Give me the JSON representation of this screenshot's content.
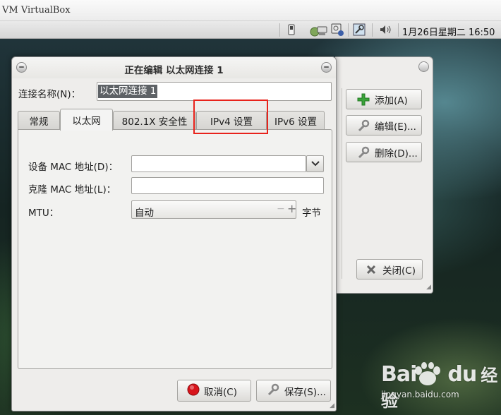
{
  "app": {
    "title": "VM VirtualBox"
  },
  "panel": {
    "clock": "1月26日星期二 16:50",
    "icons": [
      "power-indicator-icon",
      "network-manager-icon",
      "removable-drive-icon",
      "keyboard-settings-icon",
      "volume-icon"
    ]
  },
  "connections_window": {
    "buttons": {
      "add": "添加(A)",
      "edit": "编辑(E)...",
      "delete": "删除(D)...",
      "close": "关闭(C)"
    }
  },
  "editor": {
    "title": "正在编辑 以太网连接 1",
    "name_label": "连接名称(N)：",
    "name_value": "以太网连接 1",
    "tabs": [
      {
        "label": "常规",
        "active": false
      },
      {
        "label": "以太网",
        "active": true
      },
      {
        "label": "802.1X 安全性",
        "active": false
      },
      {
        "label": "IPv4 设置",
        "active": false,
        "highlighted": true
      },
      {
        "label": "IPv6 设置",
        "active": false
      }
    ],
    "ethernet": {
      "device_mac_label": "设备 MAC 地址(D)：",
      "device_mac_value": "",
      "cloned_mac_label": "克隆 MAC 地址(L)：",
      "cloned_mac_value": "",
      "mtu_label": "MTU：",
      "mtu_value": "自动",
      "mtu_unit": "字节",
      "spin_minus": "−",
      "spin_plus": "+"
    },
    "buttons": {
      "cancel": "取消(C)",
      "save": "保存(S)..."
    }
  },
  "watermark": {
    "brand": "Bai",
    "brand_suffix": "du",
    "brand_cn": "经验",
    "url": "jingyan.baidu.com"
  },
  "colors": {
    "highlight_box": "#e8231c",
    "add_icon": "#3aa33a",
    "cancel_icon": "#d8141b",
    "selection": "#5e6266"
  }
}
